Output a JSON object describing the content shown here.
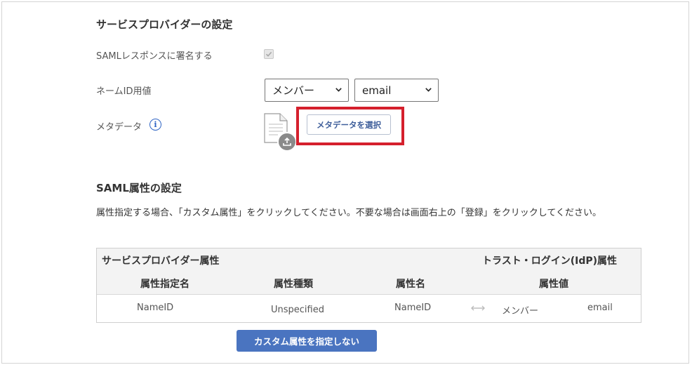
{
  "sp_section": {
    "title": "サービスプロバイダーの設定",
    "sign_label": "SAMLレスポンスに署名する",
    "nameid_label": "ネームID用値",
    "nameid_select1": "メンバー",
    "nameid_select2": "email",
    "metadata_label": "メタデータ",
    "metadata_button": "メタデータを選択"
  },
  "saml_section": {
    "title": "SAML属性の設定",
    "description": "属性指定する場合、「カスタム属性」をクリックしてください。不要な場合は画面右上の「登録」をクリックしてください。",
    "table": {
      "group_left": "サービスプロバイダー属性",
      "group_right": "トラスト・ログイン(IdP)属性",
      "columns": [
        "属性指定名",
        "属性種類",
        "属性名",
        "属性値"
      ],
      "rows": [
        {
          "attr_name": "NameID",
          "attr_type": "Unspecified",
          "name": "NameID",
          "value_source": "メンバー",
          "value": "email"
        }
      ]
    },
    "custom_button": "カスタム属性を指定しない"
  },
  "icons": [
    "checkbox-check-icon",
    "chevron-down-icon",
    "info-icon",
    "document-icon",
    "upload-icon",
    "bidirectional-arrow-icon"
  ],
  "colors": {
    "accent": "#4a74c0",
    "highlight": "#d5202d",
    "info": "#2f64c4"
  }
}
